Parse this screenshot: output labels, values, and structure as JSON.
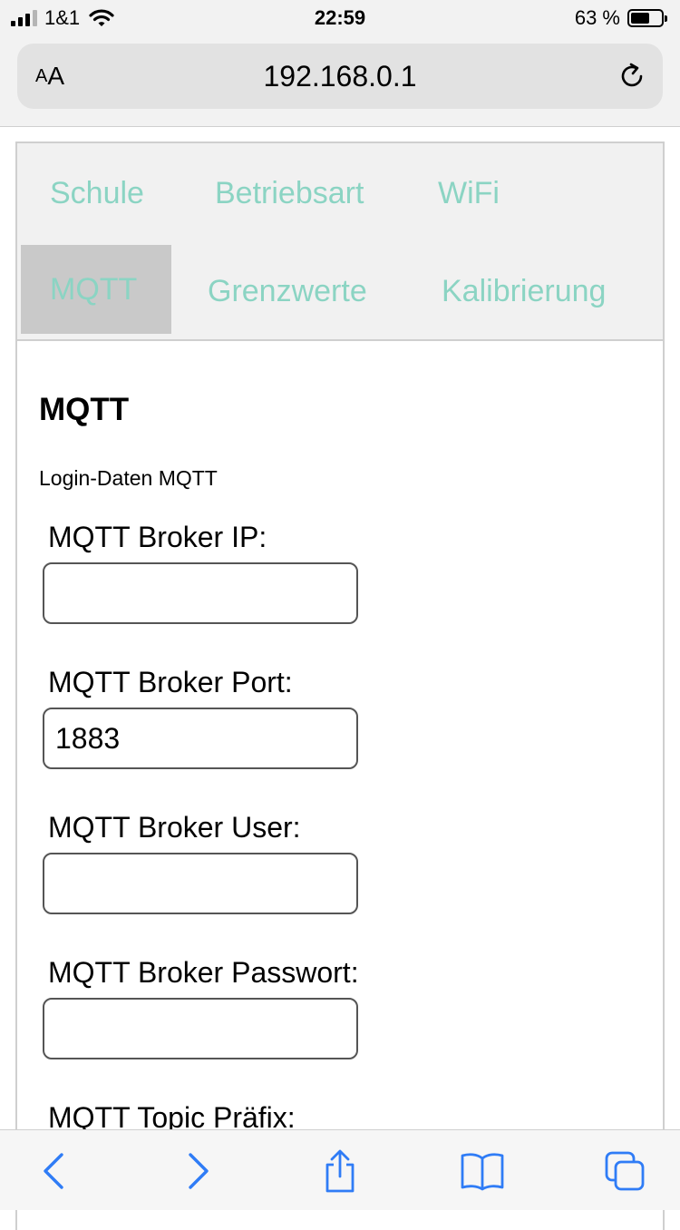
{
  "status_bar": {
    "carrier": "1&1",
    "time": "22:59",
    "battery_percent": "63 %",
    "battery_level": 0.63
  },
  "browser": {
    "text_size_button": {
      "small": "A",
      "big": "A"
    },
    "url": "192.168.0.1"
  },
  "tabs": [
    {
      "label": "Schule",
      "active": false
    },
    {
      "label": "Betriebsart",
      "active": false
    },
    {
      "label": "WiFi",
      "active": false
    },
    {
      "label": "MQTT",
      "active": true
    },
    {
      "label": "Grenzwerte",
      "active": false
    },
    {
      "label": "Kalibrierung",
      "active": false
    }
  ],
  "section": {
    "title": "MQTT",
    "subtitle": "Login-Daten MQTT"
  },
  "fields": [
    {
      "label": "MQTT Broker IP:",
      "value": ""
    },
    {
      "label": "MQTT Broker Port:",
      "value": "1883"
    },
    {
      "label": "MQTT Broker User:",
      "value": ""
    },
    {
      "label": "MQTT Broker Passwort:",
      "value": ""
    },
    {
      "label": "MQTT Topic Präfix:",
      "value": ""
    }
  ],
  "colors": {
    "tab_text": "#8bd4c3",
    "active_tab_bg": "#c9c9c9",
    "toolbar_icon": "#2f7cf6"
  },
  "toolbar": {
    "icons": [
      "back-icon",
      "forward-icon",
      "share-icon",
      "bookmarks-icon",
      "tabs-icon"
    ]
  }
}
